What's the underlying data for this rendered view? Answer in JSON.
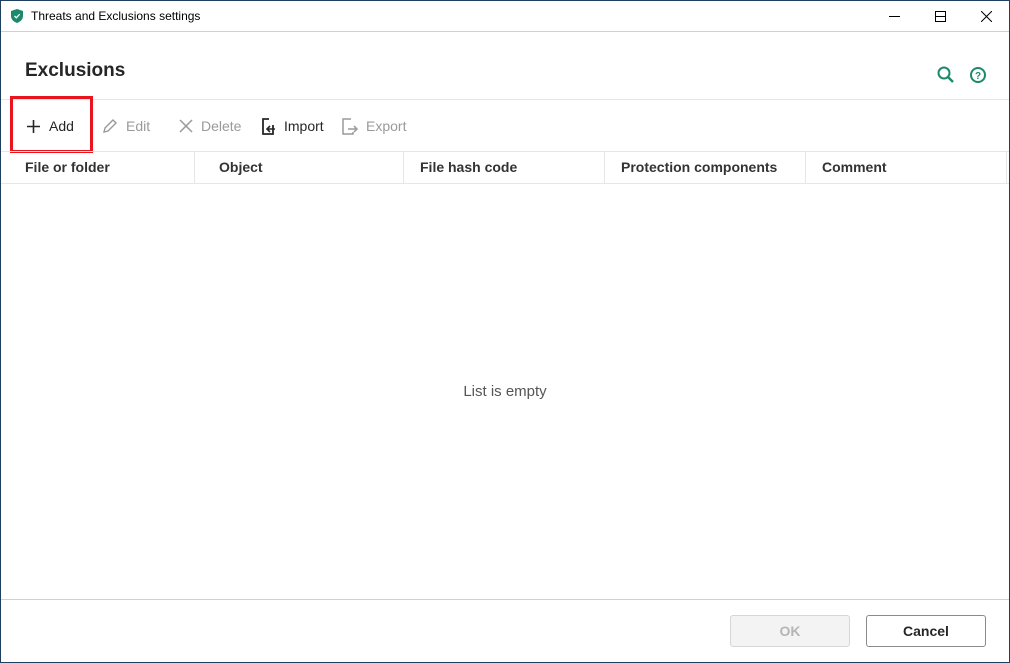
{
  "window": {
    "title": "Threats and Exclusions settings"
  },
  "page": {
    "title": "Exclusions"
  },
  "toolbar": {
    "add": "Add",
    "edit": "Edit",
    "delete": "Delete",
    "import": "Import",
    "export": "Export"
  },
  "table": {
    "columns": [
      "File or folder",
      "Object",
      "File hash code",
      "Protection components",
      "Comment"
    ],
    "empty_text": "List is empty"
  },
  "footer": {
    "ok": "OK",
    "cancel": "Cancel"
  },
  "colors": {
    "accent": "#1b8a6b",
    "highlight": "#e8141e"
  }
}
